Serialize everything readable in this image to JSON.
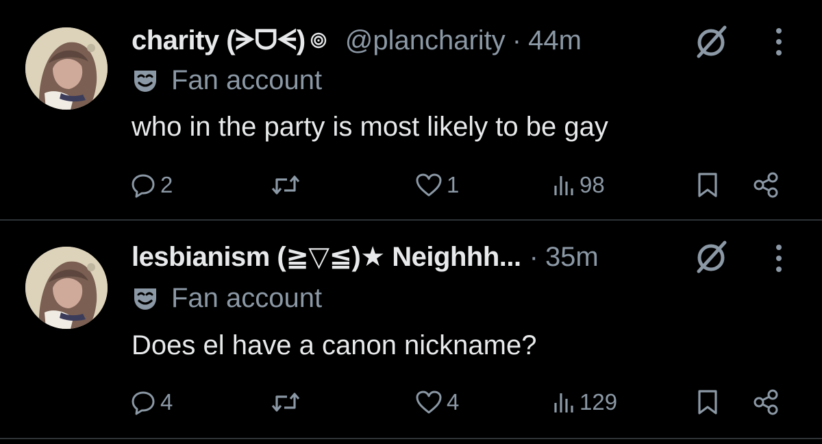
{
  "colors": {
    "background": "#000000",
    "text": "#e7e9ea",
    "muted": "#8b98a5",
    "divider": "#2f3336"
  },
  "tweets": [
    {
      "display_name": "charity (ᗒᗜᗕ)",
      "handle": "@plancharity",
      "separator": "·",
      "time": "44m",
      "label": "Fan account",
      "text": "who in the party is most likely to be gay",
      "replies": "2",
      "retweets": "",
      "likes": "1",
      "views": "98",
      "icons": [
        "avatar",
        "swirl-icon",
        "grok-icon",
        "more-icon",
        "mask-icon",
        "reply-icon",
        "retweet-icon",
        "like-icon",
        "views-icon",
        "bookmark-icon",
        "share-icon"
      ]
    },
    {
      "display_name": "lesbianism (≧▽≦)★ Neighhh...",
      "handle": "",
      "separator": "·",
      "time": "35m",
      "label": "Fan account",
      "text": "Does el have a canon nickname?",
      "replies": "4",
      "retweets": "",
      "likes": "4",
      "views": "129",
      "icons": [
        "avatar",
        "grok-icon",
        "more-icon",
        "mask-icon",
        "reply-icon",
        "retweet-icon",
        "like-icon",
        "views-icon",
        "bookmark-icon",
        "share-icon"
      ]
    }
  ]
}
